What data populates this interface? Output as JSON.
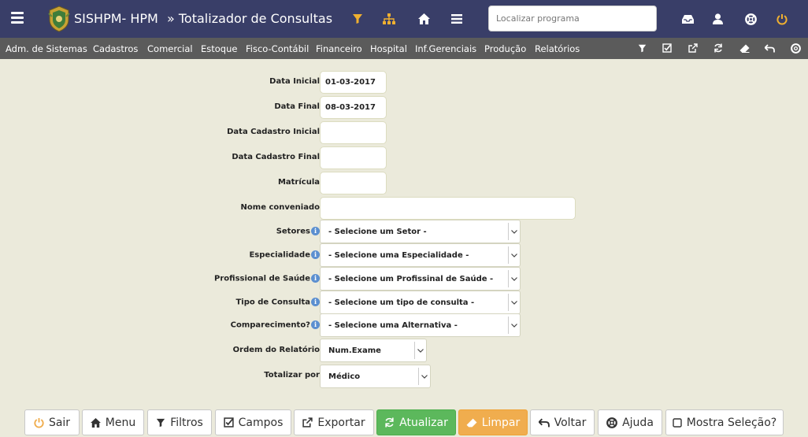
{
  "header": {
    "app_title": "SISHPM- HPM",
    "page_title": "» Totalizador de Consultas",
    "search_placeholder": "Localizar programa"
  },
  "menu": {
    "items": [
      "Adm. de Sistemas",
      "Cadastros",
      "Comercial",
      "Estoque",
      "Fisco-Contábil",
      "Financeiro",
      "Hospital",
      "Inf.Gerenciais",
      "Produção",
      "Relatórios"
    ]
  },
  "form": {
    "data_inicial": {
      "label": "Data Inicial",
      "value": "01-03-2017"
    },
    "data_final": {
      "label": "Data Final",
      "value": "08-03-2017"
    },
    "data_cadastro_inicial": {
      "label": "Data Cadastro Inicial",
      "value": ""
    },
    "data_cadastro_final": {
      "label": "Data Cadastro Final",
      "value": ""
    },
    "matricula": {
      "label": "Matrícula",
      "value": ""
    },
    "nome_conveniado": {
      "label": "Nome conveniado",
      "value": ""
    },
    "setores": {
      "label": "Setores",
      "value": "- Selecione um Setor -"
    },
    "especialidade": {
      "label": "Especialidade",
      "value": "- Selecione uma Especialidade -"
    },
    "profissional": {
      "label": "Profissional de Saúde",
      "value": "- Selecione um Profissinal de Saúde -"
    },
    "tipo_consulta": {
      "label": "Tipo de Consulta",
      "value": "- Selecione um tipo de consulta -"
    },
    "comparecimento": {
      "label": "Comparecimento?",
      "value": "- Selecione uma Alternativa -"
    },
    "ordem": {
      "label": "Ordem do Relatório",
      "value": "Num.Exame"
    },
    "totalizar": {
      "label": "Totalizar por",
      "value": "Médico"
    }
  },
  "buttons": {
    "sair": "Sair",
    "menu": "Menu",
    "filtros": "Filtros",
    "campos": "Campos",
    "exportar": "Exportar",
    "atualizar": "Atualizar",
    "limpar": "Limpar",
    "voltar": "Voltar",
    "ajuda": "Ajuda",
    "mostra_selecao": "Mostra Seleção?"
  },
  "colors": {
    "topbar": "#393e68",
    "menubar": "#5b5b5b",
    "accent_orange": "#f0ad4e",
    "accent_green": "#5cb85c",
    "icon_yellow": "#f0b030"
  }
}
